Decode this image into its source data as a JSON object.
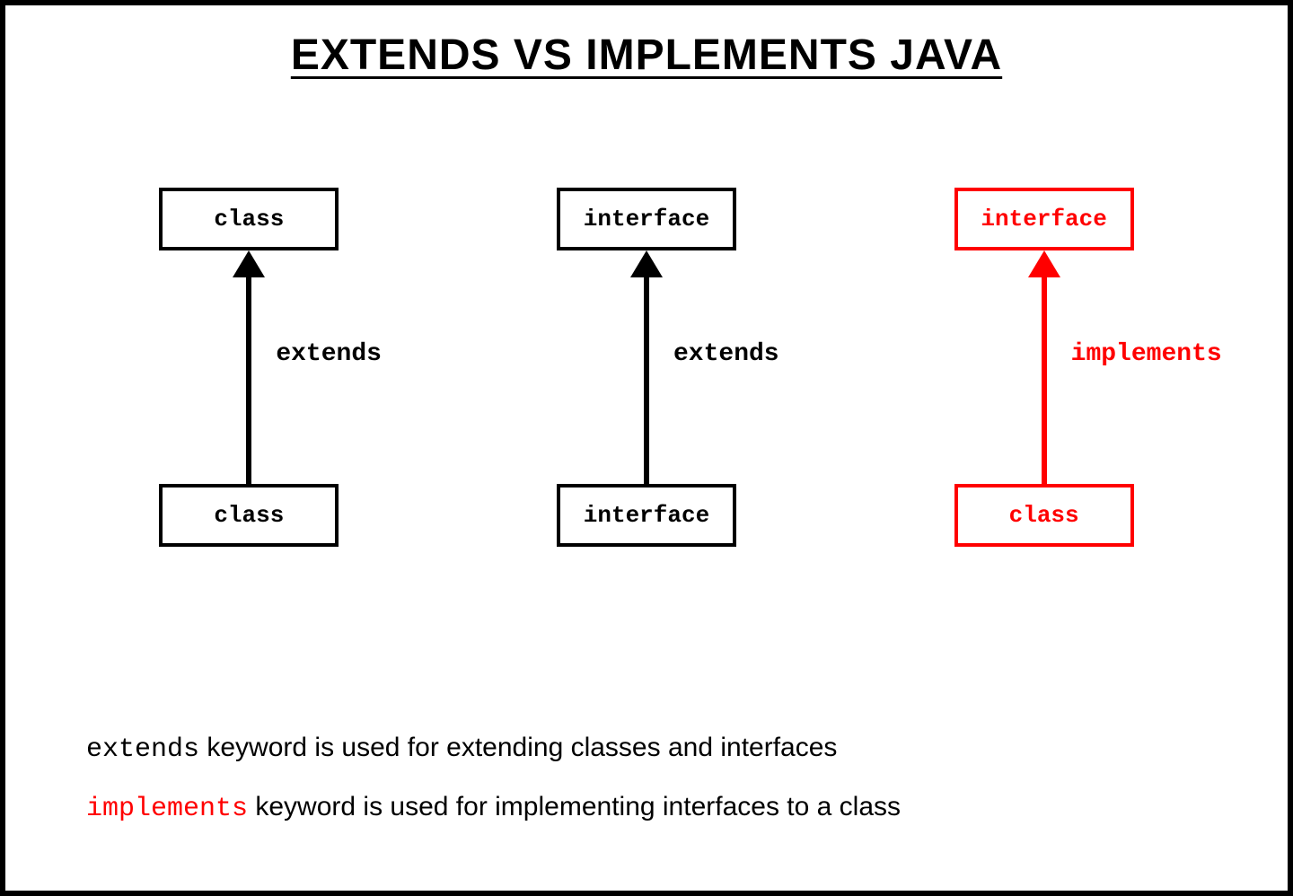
{
  "title": "EXTENDS VS IMPLEMENTS JAVA",
  "columns": [
    {
      "top": "class",
      "bottom": "class",
      "keyword": "extends",
      "variant": "black"
    },
    {
      "top": "interface",
      "bottom": "interface",
      "keyword": "extends",
      "variant": "black"
    },
    {
      "top": "interface",
      "bottom": "class",
      "keyword": "implements",
      "variant": "red"
    }
  ],
  "notes": [
    {
      "kw": "extends",
      "kw_variant": "black",
      "rest": " keyword is used for extending classes and interfaces"
    },
    {
      "kw": "implements",
      "kw_variant": "red",
      "rest": " keyword is used for implementing interfaces to a class"
    }
  ]
}
